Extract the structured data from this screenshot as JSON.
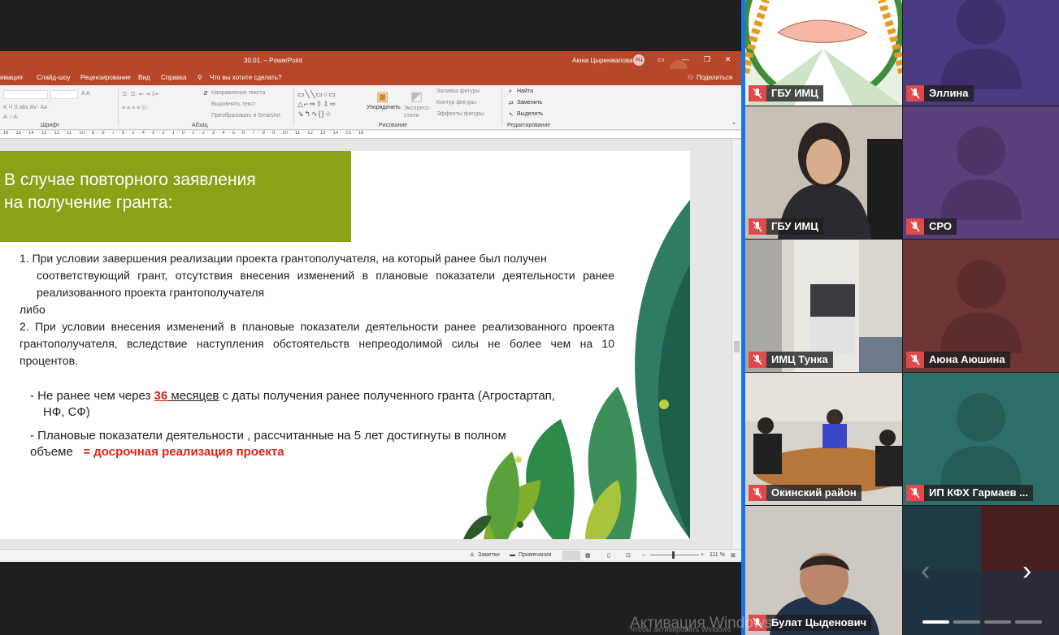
{
  "ppt": {
    "title": "30.01. – PowerPoint",
    "user": "Аюна Цыренжапова",
    "user_initials": "АЦ",
    "tabs": [
      "имация",
      "Слайд-шоу",
      "Рецензирование",
      "Вид",
      "Справка"
    ],
    "tell_me": "Что вы хотите сделать?",
    "share": "Поделиться",
    "groups": [
      "Шрифт",
      "Абзац",
      "Рисование",
      "Редактирование"
    ],
    "ribbon": {
      "text_direction": "Направление текста",
      "align_text": "Выровнять текст",
      "smartart": "Преобразовать в SmartArt",
      "arrange": "Упорядочить",
      "quick_styles": "Экспресс-стили",
      "shape_fill": "Заливка фигуры",
      "shape_outline": "Контур фигуры",
      "shape_effects": "Эффекты фигуры",
      "find": "Найти",
      "replace": "Заменить",
      "select": "Выделить"
    },
    "ruler": "· 16 · · 15 · · 14 · · 13 · · 12 · · 11 · · 10 · · 9 · · 8 · · 7 · · 6 · · 5 · · 4 · · 3 · · 2 · · 1 · · 0 · · 1 · · 2 · · 3 · · 4 · · 5 · · 6 · · 7 · · 8 · · 9 · · 10 · · 11 · · 12 · · 13 · · 14 · · 15 · · 16 ·",
    "status": {
      "notes": "Заметки",
      "comments": "Примечания",
      "zoom": "111 %"
    }
  },
  "slide": {
    "title_line1": "В случае повторного заявления",
    "title_line2": "на получение гранта:",
    "item1_a": "1.  При условии завершения реализации проекта грантополучателя, на который ранее был получен",
    "item1_b": "соответствующий грант, отсутствия внесения изменений в плановые показатели деятельности ранее реализованного проекта грантополучателя",
    "or": "либо",
    "item2": "2. При условии внесения изменений в плановые показатели деятельности ранее реализованного проекта грантополучателя, вследствие наступления обстоятельств непреодолимой силы не более чем на 10 процентов.",
    "bullet1_pre": "-  Не ранее чем через ",
    "bullet1_num": "36",
    "bullet1_unit": " месяцев",
    "bullet1_post": " с даты получения ранее полученного гранта (Агростартап,",
    "bullet1_line2": "НФ, СФ)",
    "bullet2_line1": "-     Плановые показатели деятельности , рассчитанные на      5 лет достигнуты в полном",
    "bullet2_line2": "объеме",
    "bullet2_red": "= досрочная реализация проекта"
  },
  "participants": [
    {
      "name": "ГБУ ИМЦ"
    },
    {
      "name": "Эллина"
    },
    {
      "name": "ГБУ ИМЦ"
    },
    {
      "name": "СРО"
    },
    {
      "name": "ИМЦ Тунка"
    },
    {
      "name": "Аюна Аюшина"
    },
    {
      "name": "Окинский район"
    },
    {
      "name": "ИП КФХ Гармаев ..."
    },
    {
      "name": "Булат Цыденович"
    }
  ],
  "colors": {
    "ppt_accent": "#b7472a",
    "slide_green": "#8aa118",
    "highlight_red": "#e0221a",
    "tile_purple": "#4a3b80",
    "tile_teal": "#2e6e6a",
    "tile_maroon": "#6e3535"
  },
  "watermark": "Активация Windows",
  "watermark2": "Чтобы активировать Windows"
}
